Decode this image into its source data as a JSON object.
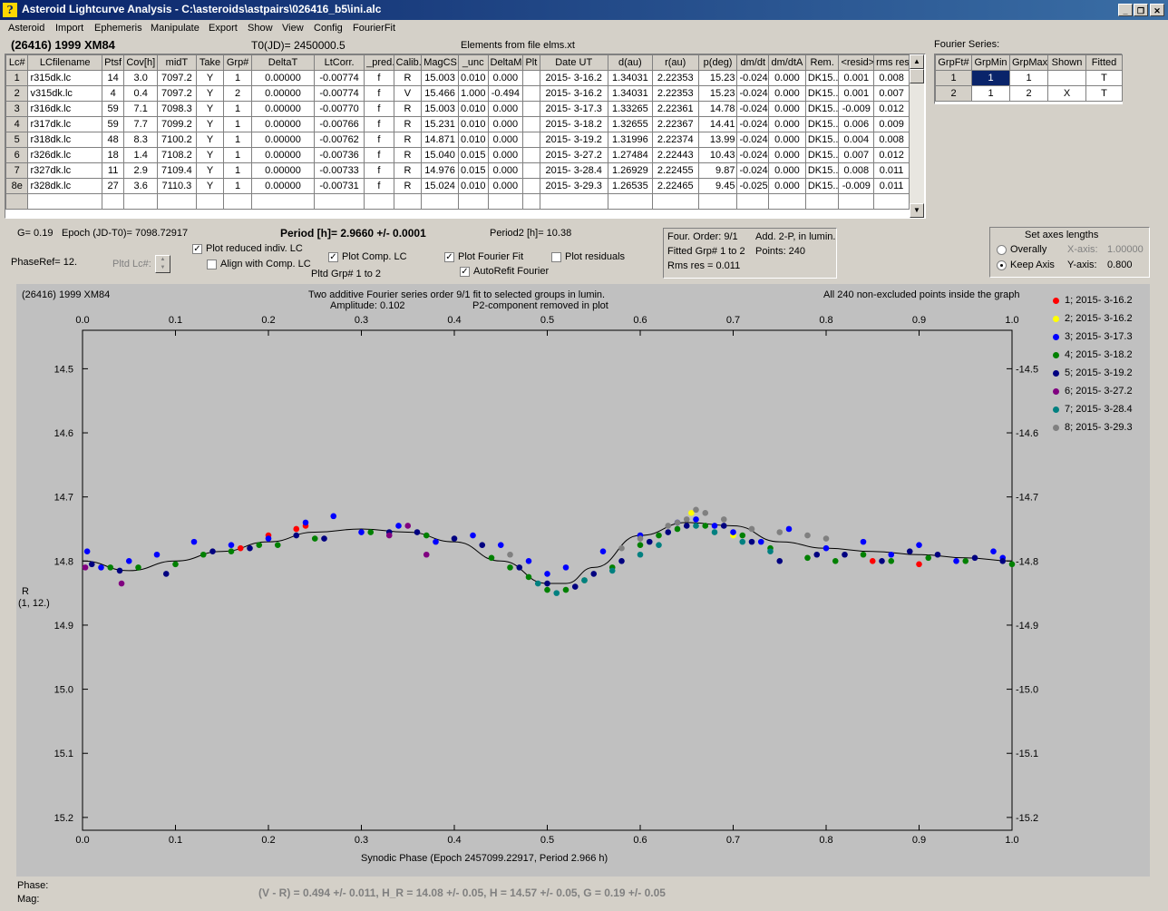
{
  "window": {
    "title": "Asteroid Lightcurve Analysis - C:\\asteroids\\astpairs\\026416_b5\\ini.alc",
    "app_icon": "program-icon",
    "buttons": [
      "minimize-icon",
      "restore-icon",
      "close-icon"
    ]
  },
  "menu": [
    "Asteroid",
    "Import",
    "Ephemeris",
    "Manipulate",
    "Export",
    "Show",
    "View",
    "Config",
    "FourierFit"
  ],
  "header": {
    "asteroid": "(26416) 1999 XM84",
    "t0": "T0(JD)= 2450000.5",
    "elements": "Elements from file elms.xt"
  },
  "lc_table": {
    "columns": [
      "Lc#",
      "LCfilename",
      "Ptsf",
      "Cov[h]",
      "midT",
      "Take",
      "Grp#",
      "DeltaT",
      "LtCorr.",
      "_pred.",
      "Calib.",
      "MagCS",
      "_unc",
      "DeltaM",
      "Plt",
      "Date UT",
      "d(au)",
      "r(au)",
      "p(deg)",
      "dm/dt",
      "dm/dtA",
      "Rem.",
      "<resid>",
      "rms res"
    ],
    "rows": [
      [
        "1",
        "r315dk.lc",
        "14",
        "3.0",
        "7097.2",
        "Y",
        "1",
        "0.00000",
        "-0.00774",
        "f",
        "R",
        "15.003",
        "0.010",
        "0.000",
        "",
        "2015- 3-16.2",
        "1.34031",
        "2.22353",
        "15.23",
        "-0.024",
        "0.000",
        "DK15..",
        "0.001",
        "0.008"
      ],
      [
        "2",
        "v315dk.lc",
        "4",
        "0.4",
        "7097.2",
        "Y",
        "2",
        "0.00000",
        "-0.00774",
        "f",
        "V",
        "15.466",
        "1.000",
        "-0.494",
        "",
        "2015- 3-16.2",
        "1.34031",
        "2.22353",
        "15.23",
        "-0.024",
        "0.000",
        "DK15..",
        "0.001",
        "0.007"
      ],
      [
        "3",
        "r316dk.lc",
        "59",
        "7.1",
        "7098.3",
        "Y",
        "1",
        "0.00000",
        "-0.00770",
        "f",
        "R",
        "15.003",
        "0.010",
        "0.000",
        "",
        "2015- 3-17.3",
        "1.33265",
        "2.22361",
        "14.78",
        "-0.024",
        "0.000",
        "DK15..",
        "-0.009",
        "0.012"
      ],
      [
        "4",
        "r317dk.lc",
        "59",
        "7.7",
        "7099.2",
        "Y",
        "1",
        "0.00000",
        "-0.00766",
        "f",
        "R",
        "15.231",
        "0.010",
        "0.000",
        "",
        "2015- 3-18.2",
        "1.32655",
        "2.22367",
        "14.41",
        "-0.024",
        "0.000",
        "DK15..",
        "0.006",
        "0.009"
      ],
      [
        "5",
        "r318dk.lc",
        "48",
        "8.3",
        "7100.2",
        "Y",
        "1",
        "0.00000",
        "-0.00762",
        "f",
        "R",
        "14.871",
        "0.010",
        "0.000",
        "",
        "2015- 3-19.2",
        "1.31996",
        "2.22374",
        "13.99",
        "-0.024",
        "0.000",
        "DK15..",
        "0.004",
        "0.008"
      ],
      [
        "6",
        "r326dk.lc",
        "18",
        "1.4",
        "7108.2",
        "Y",
        "1",
        "0.00000",
        "-0.00736",
        "f",
        "R",
        "15.040",
        "0.015",
        "0.000",
        "",
        "2015- 3-27.2",
        "1.27484",
        "2.22443",
        "10.43",
        "-0.024",
        "0.000",
        "DK15..",
        "0.007",
        "0.012"
      ],
      [
        "7",
        "r327dk.lc",
        "11",
        "2.9",
        "7109.4",
        "Y",
        "1",
        "0.00000",
        "-0.00733",
        "f",
        "R",
        "14.976",
        "0.015",
        "0.000",
        "",
        "2015- 3-28.4",
        "1.26929",
        "2.22455",
        "9.87",
        "-0.024",
        "0.000",
        "DK15..",
        "0.008",
        "0.011"
      ],
      [
        "8e",
        "r328dk.lc",
        "27",
        "3.6",
        "7110.3",
        "Y",
        "1",
        "0.00000",
        "-0.00731",
        "f",
        "R",
        "15.024",
        "0.010",
        "0.000",
        "",
        "2015- 3-29.3",
        "1.26535",
        "2.22465",
        "9.45",
        "-0.025",
        "0.000",
        "DK15..",
        "-0.009",
        "0.011"
      ]
    ]
  },
  "fourier_table": {
    "title": "Fourier Series:",
    "columns": [
      "GrpFt#",
      "GrpMin",
      "GrpMax",
      "Shown",
      "Fitted"
    ],
    "rows": [
      [
        "1",
        "1",
        "1",
        "",
        "T"
      ],
      [
        "2",
        "1",
        "2",
        "X",
        "T"
      ]
    ]
  },
  "info": {
    "g": "G= 0.19",
    "epoch": "Epoch (JD-T0)= 7098.72917",
    "period": "Period [h]= 2.9660 +/- 0.0001",
    "period2": "Period2 [h]= 10.38",
    "phaseref": "PhaseRef= 12.",
    "pltd_lc": "Pltd Lc#:",
    "pltd_grp": "Pltd Grp#  1   to   2"
  },
  "checks": {
    "plot_reduced": {
      "label": "Plot reduced indiv. LC",
      "checked": true
    },
    "align_comp": {
      "label": "Align with Comp. LC",
      "checked": false
    },
    "plot_comp": {
      "label": "Plot Comp. LC",
      "checked": true
    },
    "plot_fourier": {
      "label": "Plot Fourier Fit",
      "checked": true
    },
    "autorefit": {
      "label": "AutoRefit Fourier",
      "checked": true
    },
    "plot_residuals": {
      "label": "Plot residuals",
      "checked": false
    }
  },
  "fit_box": {
    "order": "Four. Order:  9/1",
    "add": "Add. 2-P, in lumin.",
    "fitted": "Fitted Grp# 1 to 2",
    "points": "Points: 240",
    "rms": "Rms res     = 0.011"
  },
  "axes_box": {
    "title": "Set axes lengths",
    "overall": "Overally",
    "keep": "Keep Axis",
    "selected": "keep",
    "xaxis_label": "X-axis:",
    "xaxis_value": "1.00000",
    "yaxis_label": "Y-axis:",
    "yaxis_value": "0.800"
  },
  "plot": {
    "corner_label": "(26416) 1999 XM84",
    "caption1": "Two additive Fourier series order 9/1 fit to selected groups in lumin.",
    "caption2_left": "Amplitude: 0.102",
    "caption2_right": "P2-component removed in plot",
    "note": "All 240 non-excluded points inside the graph",
    "ylabel1": "R",
    "ylabel2": "(1, 12.)"
  },
  "chart_data": {
    "type": "scatter",
    "xlabel": "Synodic Phase (Epoch 2457099.22917, Period 2.966 h)",
    "ylabel": "R",
    "xlim": [
      0.0,
      1.0
    ],
    "ylim": [
      15.22,
      14.44
    ],
    "x_ticks": [
      "0.0",
      "0.1",
      "0.2",
      "0.3",
      "0.4",
      "0.5",
      "0.6",
      "0.7",
      "0.8",
      "0.9",
      "1.0"
    ],
    "y_ticks": [
      "14.5",
      "14.6",
      "14.7",
      "14.8",
      "14.9",
      "15.0",
      "15.1",
      "15.2"
    ],
    "legend_position": "right",
    "fit_curve": {
      "x": [
        0.0,
        0.05,
        0.1,
        0.15,
        0.2,
        0.25,
        0.3,
        0.35,
        0.4,
        0.45,
        0.5,
        0.52,
        0.55,
        0.6,
        0.65,
        0.7,
        0.75,
        0.8,
        0.85,
        0.9,
        0.95,
        1.0
      ],
      "y": [
        14.8,
        14.815,
        14.8,
        14.785,
        14.77,
        14.755,
        14.75,
        14.755,
        14.77,
        14.8,
        14.835,
        14.835,
        14.81,
        14.76,
        14.74,
        14.745,
        14.77,
        14.78,
        14.785,
        14.79,
        14.795,
        14.8
      ]
    },
    "series": [
      {
        "name": "1; 2015- 3-16.2",
        "color": "#ff0000",
        "x": [
          0.17,
          0.2,
          0.23,
          0.24,
          0.85,
          0.9
        ],
        "y": [
          14.78,
          14.76,
          14.75,
          14.745,
          14.8,
          14.805
        ]
      },
      {
        "name": "2; 2015- 3-16.2",
        "color": "#ffff00",
        "x": [
          0.655,
          0.7
        ],
        "y": [
          14.725,
          14.76
        ]
      },
      {
        "name": "3; 2015- 3-17.3",
        "color": "#0000ff",
        "x": [
          0.005,
          0.02,
          0.05,
          0.08,
          0.12,
          0.16,
          0.2,
          0.24,
          0.27,
          0.3,
          0.34,
          0.38,
          0.42,
          0.45,
          0.48,
          0.5,
          0.52,
          0.56,
          0.6,
          0.64,
          0.66,
          0.68,
          0.7,
          0.73,
          0.76,
          0.8,
          0.84,
          0.87,
          0.9,
          0.94,
          0.98,
          0.99
        ],
        "y": [
          14.785,
          14.81,
          14.8,
          14.79,
          14.77,
          14.775,
          14.765,
          14.74,
          14.73,
          14.755,
          14.745,
          14.77,
          14.76,
          14.775,
          14.8,
          14.82,
          14.81,
          14.785,
          14.76,
          14.74,
          14.735,
          14.745,
          14.755,
          14.77,
          14.75,
          14.78,
          14.77,
          14.79,
          14.775,
          14.8,
          14.785,
          14.795
        ]
      },
      {
        "name": "4; 2015- 3-18.2",
        "color": "#008000",
        "x": [
          0.03,
          0.06,
          0.1,
          0.13,
          0.16,
          0.19,
          0.21,
          0.25,
          0.31,
          0.37,
          0.44,
          0.46,
          0.48,
          0.5,
          0.52,
          0.54,
          0.57,
          0.6,
          0.62,
          0.64,
          0.67,
          0.71,
          0.74,
          0.78,
          0.81,
          0.84,
          0.87,
          0.91,
          0.95,
          1.0
        ],
        "y": [
          14.81,
          14.81,
          14.805,
          14.79,
          14.785,
          14.775,
          14.775,
          14.765,
          14.755,
          14.76,
          14.795,
          14.81,
          14.825,
          14.845,
          14.845,
          14.83,
          14.81,
          14.775,
          14.76,
          14.75,
          14.745,
          14.76,
          14.78,
          14.795,
          14.8,
          14.79,
          14.8,
          14.795,
          14.8,
          14.805
        ]
      },
      {
        "name": "5; 2015- 3-19.2",
        "color": "#000080",
        "x": [
          0.01,
          0.04,
          0.09,
          0.14,
          0.18,
          0.23,
          0.26,
          0.33,
          0.36,
          0.4,
          0.43,
          0.47,
          0.5,
          0.53,
          0.55,
          0.58,
          0.61,
          0.63,
          0.65,
          0.69,
          0.72,
          0.75,
          0.79,
          0.82,
          0.86,
          0.89,
          0.92,
          0.96,
          0.99
        ],
        "y": [
          14.805,
          14.815,
          14.82,
          14.785,
          14.78,
          14.76,
          14.765,
          14.755,
          14.755,
          14.765,
          14.775,
          14.81,
          14.835,
          14.84,
          14.82,
          14.8,
          14.77,
          14.755,
          14.745,
          14.745,
          14.77,
          14.8,
          14.79,
          14.79,
          14.8,
          14.785,
          14.79,
          14.795,
          14.8
        ]
      },
      {
        "name": "6; 2015- 3-27.2",
        "color": "#800080",
        "x": [
          0.003,
          0.042,
          0.33,
          0.35,
          0.37
        ],
        "y": [
          14.81,
          14.835,
          14.76,
          14.745,
          14.79
        ]
      },
      {
        "name": "7; 2015- 3-28.4",
        "color": "#008080",
        "x": [
          0.49,
          0.51,
          0.54,
          0.57,
          0.6,
          0.62,
          0.66,
          0.68,
          0.71,
          0.74
        ],
        "y": [
          14.835,
          14.85,
          14.83,
          14.815,
          14.79,
          14.775,
          14.745,
          14.755,
          14.77,
          14.785
        ]
      },
      {
        "name": "8; 2015- 3-29.3",
        "color": "#808080",
        "x": [
          0.46,
          0.58,
          0.6,
          0.63,
          0.64,
          0.65,
          0.66,
          0.67,
          0.69,
          0.72,
          0.75,
          0.78,
          0.8
        ],
        "y": [
          14.79,
          14.78,
          14.765,
          14.745,
          14.74,
          14.735,
          14.72,
          14.725,
          14.735,
          14.75,
          14.755,
          14.76,
          14.765
        ]
      }
    ]
  },
  "footer": {
    "phase": "Phase:",
    "mag": "Mag:",
    "result": "(V - R) = 0.494 +/- 0.011, H_R = 14.08 +/- 0.05, H = 14.57 +/- 0.05,  G = 0.19 +/- 0.05"
  }
}
